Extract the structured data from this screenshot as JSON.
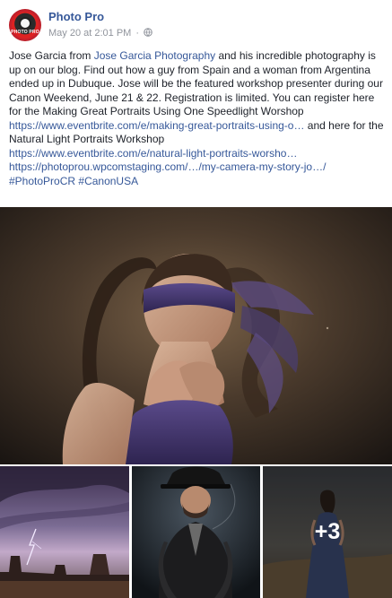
{
  "post": {
    "author": "Photo Pro",
    "timestamp": "May 20 at 2:01 PM",
    "separator": "·",
    "visibility_icon": "globe-icon",
    "avatar_text": "PHOTO PRO",
    "text": {
      "p1": "Jose Garcia from ",
      "link_photographer": "Jose Garcia Photography",
      "p2": " and his incredible photography is up on our blog. Find out how a guy from Spain and a woman from Argentina ended up in Dubuque. Jose will be the featured workshop presenter during our Canon Weekend, June 21 & 22. Registration is limited. You can register here for the Making Great Portraits Using One Speedlight Worshop ",
      "link1": "https://www.eventbrite.com/e/making-great-portraits-using-o…",
      "p3": " and here for the Natural Light Portraits Workshop ",
      "link2": "https://www.eventbrite.com/e/natural-light-portraits-worsho…",
      "link3": "https://photoprou.wpcomstaging.com/…/my-camera-my-story-jo…/",
      "hashtag1": "#PhotoProCR",
      "hashtag2": "#CanonUSA"
    },
    "photos": {
      "main_alt": "blindfolded woman portrait",
      "thumb1_alt": "lightning over buttes",
      "thumb2_alt": "man in hat and suit",
      "thumb3_alt": "woman in long dress",
      "more_count": "+3"
    }
  },
  "colors": {
    "link": "#365899",
    "meta": "#90949c",
    "text": "#1d2129"
  }
}
